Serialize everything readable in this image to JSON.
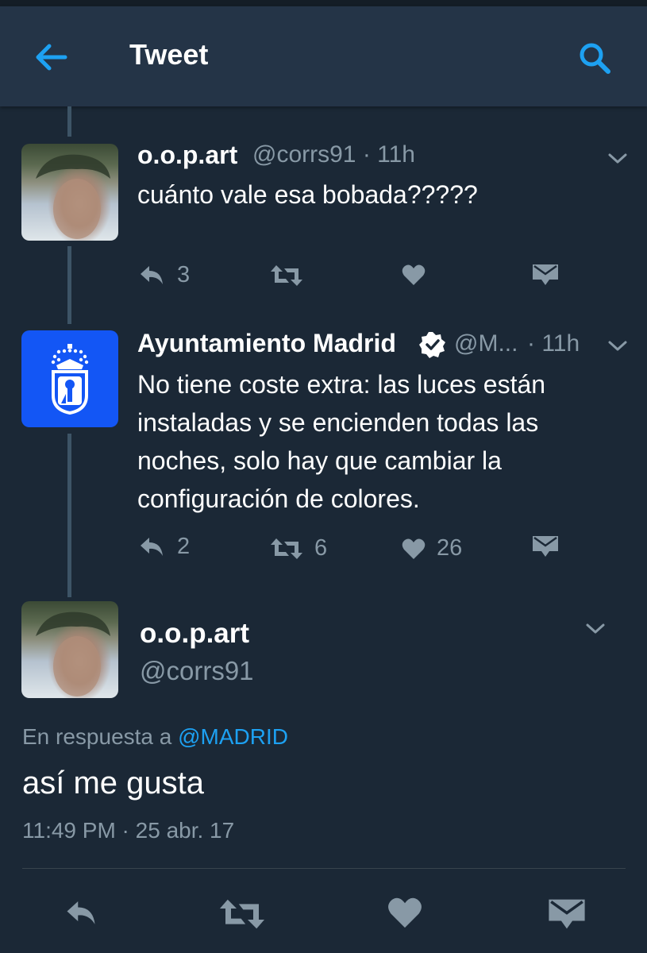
{
  "header": {
    "title": "Tweet",
    "back_icon": "arrow-left-icon",
    "search_icon": "search-icon",
    "accent_color": "#1da1f2"
  },
  "tweets": [
    {
      "name": "o.o.p.art",
      "handle": "@corrs91",
      "time": "· 11h",
      "text": "cuánto vale esa bobada?????",
      "reply_count": "3",
      "retweet_count": "",
      "like_count": "",
      "avatar": "user-photo"
    },
    {
      "name": "Ayuntamiento Madrid",
      "verified": true,
      "handle": "@M...",
      "time": "· 11h",
      "text": "No tiene coste extra: las luces están instaladas y se encienden todas las noches, solo hay que cambiar la configuración de colores.",
      "reply_count": "2",
      "retweet_count": "6",
      "like_count": "26",
      "avatar": "madrid-coat-of-arms",
      "avatar_color": "#1356f5"
    }
  ],
  "main_tweet": {
    "name": "o.o.p.art",
    "handle": "@corrs91",
    "reply_prefix": "En respuesta a",
    "reply_mention": "@MADRID",
    "text": "así me gusta",
    "timestamp": "11:49 PM · 25 abr. 17"
  },
  "bottom_actions": [
    "reply-icon",
    "retweet-icon",
    "like-icon",
    "direct-message-icon"
  ]
}
